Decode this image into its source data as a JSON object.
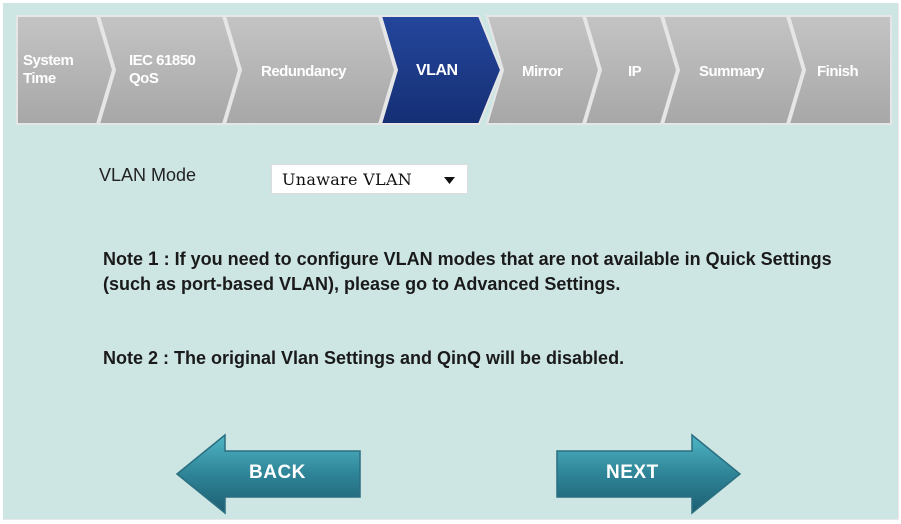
{
  "wizard": {
    "steps": [
      {
        "label": "System\nTime",
        "active": false
      },
      {
        "label": "IEC 61850\nQoS",
        "active": false
      },
      {
        "label": "Redundancy",
        "active": false
      },
      {
        "label": "VLAN",
        "active": true
      },
      {
        "label": "Mirror",
        "active": false
      },
      {
        "label": "IP",
        "active": false
      },
      {
        "label": "Summary",
        "active": false
      },
      {
        "label": "Finish",
        "active": false
      }
    ],
    "colors": {
      "inactive": "#b3b3b3",
      "active": "#1d3a8a",
      "separator": "#e6e6e6"
    }
  },
  "form": {
    "vlan_mode_label": "VLAN Mode",
    "vlan_mode_value": "Unaware VLAN"
  },
  "notes": {
    "note1_prefix": "Note ",
    "note1_number": "1",
    "note1_text": " : If you need to configure VLAN modes that are not available in Quick Settings (such as port-based VLAN), please go to Advanced Settings.",
    "note2_text": "Note 2 : The original Vlan Settings and QinQ will be disabled."
  },
  "nav": {
    "back_label": "BACK",
    "next_label": "NEXT",
    "arrow_color": "#3a8fa0"
  }
}
